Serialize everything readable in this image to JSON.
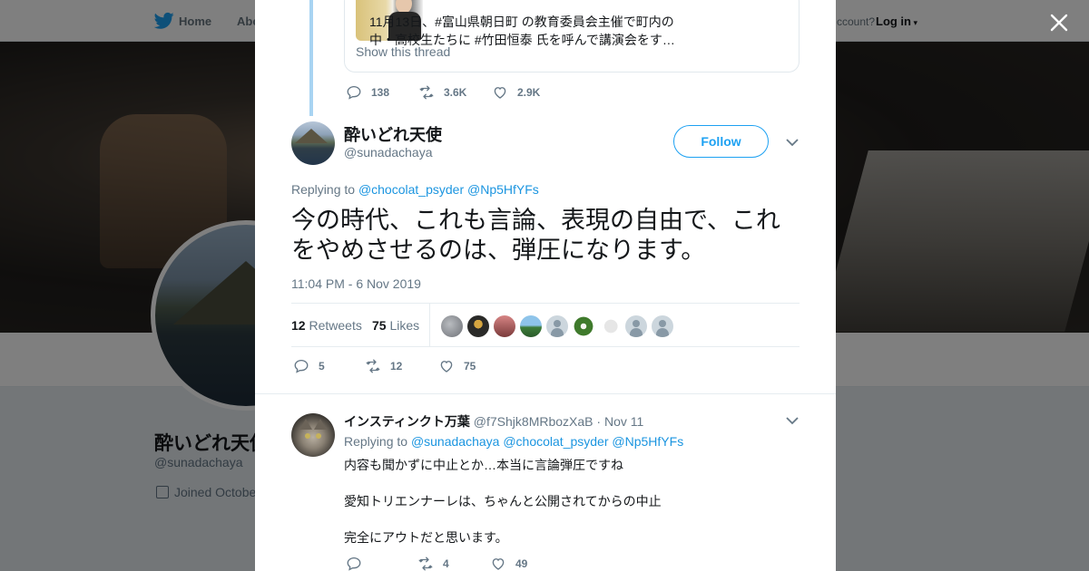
{
  "nav": {
    "home": "Home",
    "about": "Abo",
    "account": "ccount?",
    "login": "Log in"
  },
  "profile": {
    "name": "酔いどれ天使",
    "handle": "@sunadachaya",
    "joined": "Joined Octobe"
  },
  "thread_preview": {
    "text_lines": [
      "11月13日、#富山県朝日町 の教育委員会主催で町内の",
      "中・高校生たちに #竹田恒泰 氏を呼んで講演会をす…"
    ],
    "show_thread": "Show this thread",
    "replies": "138",
    "retweets": "3.6K",
    "likes": "2.9K"
  },
  "tweet": {
    "name": "酔いどれ天使",
    "handle": "@sunadachaya",
    "follow_label": "Follow",
    "replying_prefix": "Replying to",
    "replying_to": [
      "@chocolat_psyder",
      "@Np5HfYFs"
    ],
    "body_lines": [
      "今の時代、これも言論、表現の自由で、これ",
      "をやめさせるのは、弾圧になります。"
    ],
    "timestamp": "11:04 PM - 6 Nov 2019",
    "retweet_count": "12",
    "retweet_label": "Retweets",
    "like_count": "75",
    "like_label": "Likes",
    "replies": "5",
    "retweets": "12",
    "likes": "75"
  },
  "reply": {
    "name": "インスティンクト万葉",
    "handle": "@f7Shjk8MRbozXaB",
    "date": "Nov 11",
    "replying_prefix": "Replying to",
    "replying_to": [
      "@sunadachaya",
      "@chocolat_psyder",
      "@Np5HfYFs"
    ],
    "lines": [
      "内容も聞かずに中止とか…本当に言論弾圧ですね",
      "愛知トリエンナーレは、ちゃんと公開されてからの中止",
      "完全にアウトだと思います。"
    ],
    "replies": "",
    "retweets": "4",
    "likes": "49"
  },
  "colors": {
    "accent": "#1da1f2",
    "link": "#1b95e0",
    "muted": "#657786",
    "thread_line": "#a8d4f2"
  }
}
